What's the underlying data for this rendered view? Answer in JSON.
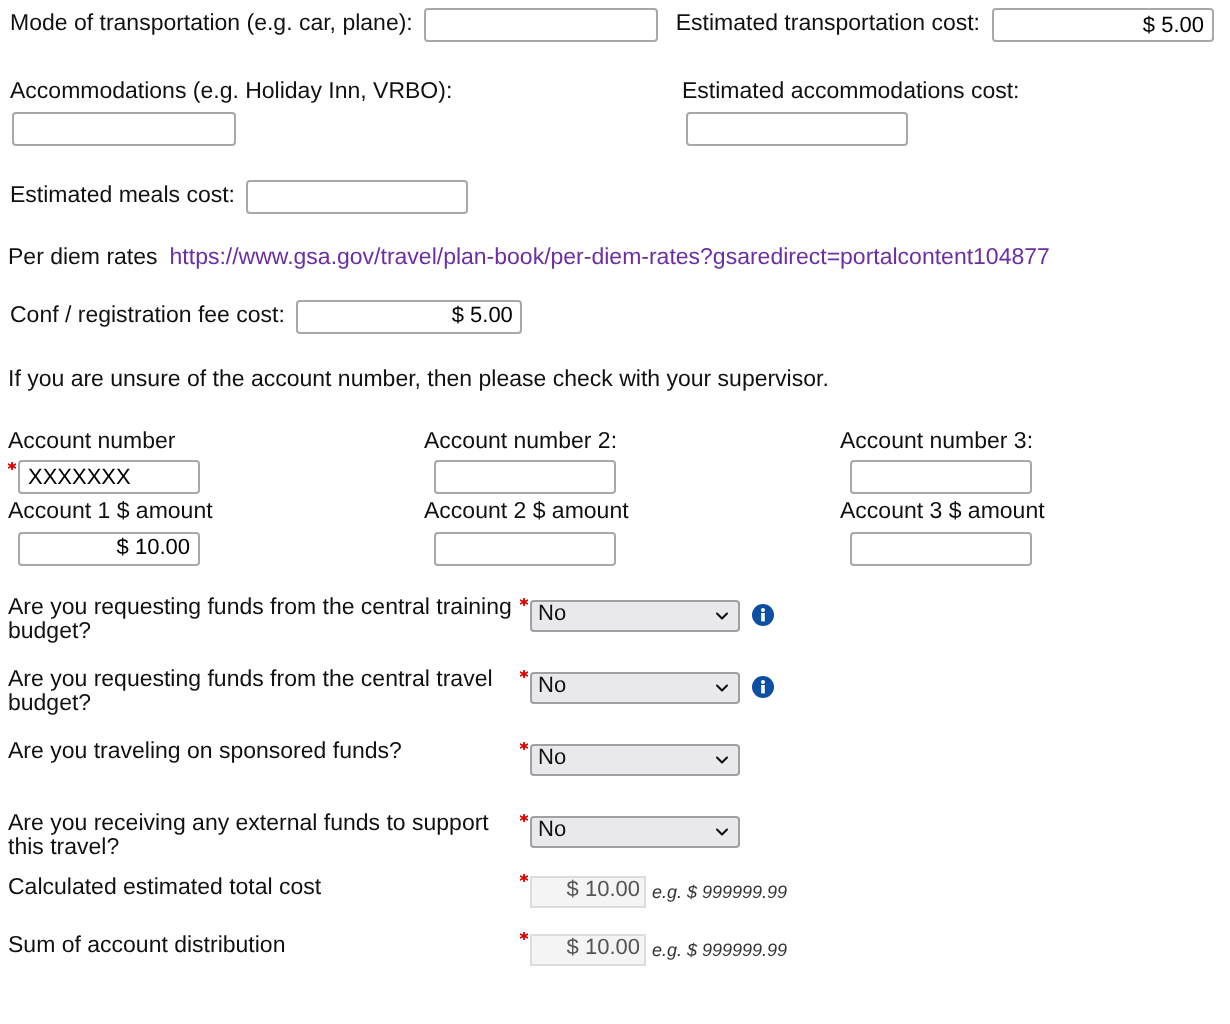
{
  "transportation": {
    "label": "Mode of transportation (e.g. car, plane):"
  },
  "transportation_cost": {
    "label": "Estimated transportation cost:",
    "value": "$ 5.00"
  },
  "accommodations": {
    "label": "Accommodations (e.g. Holiday Inn, VRBO):"
  },
  "accommodations_cost": {
    "label": "Estimated accommodations cost:"
  },
  "meals_cost": {
    "label": "Estimated meals cost:"
  },
  "per_diem": {
    "label": "Per diem rates",
    "link": "https://www.gsa.gov/travel/plan-book/per-diem-rates?gsaredirect=portalcontent104877"
  },
  "registration_cost": {
    "label": "Conf / registration fee cost:",
    "value": "$ 5.00"
  },
  "account_note": "If you are unsure of the account number, then please check with your supervisor.",
  "accounts": [
    {
      "number_label": "Account number",
      "number_value": "XXXXXXX",
      "required": true,
      "amount_label": "Account 1 $ amount",
      "amount_value": "$ 10.00"
    },
    {
      "number_label": "Account number 2:",
      "required": false,
      "amount_label": "Account 2 $ amount"
    },
    {
      "number_label": "Account number 3:",
      "required": false,
      "amount_label": "Account 3 $ amount"
    }
  ],
  "questions": [
    {
      "label": "Are you requesting funds from the central training budget?",
      "required": true,
      "value": "No",
      "info": true
    },
    {
      "label": "Are you requesting funds from the central travel budget?",
      "required": true,
      "value": "No",
      "info": true
    },
    {
      "label": "Are you traveling on sponsored funds?",
      "required": true,
      "value": "No",
      "info": false
    },
    {
      "label": "Are you receiving any external funds to support this travel?",
      "required": true,
      "value": "No",
      "info": false
    }
  ],
  "totals": [
    {
      "label": "Calculated estimated total cost",
      "required": true,
      "value": "$ 10.00",
      "hint": "e.g. $ 999999.99"
    },
    {
      "label": "Sum of account distribution",
      "required": true,
      "value": "$ 10.00",
      "hint": "e.g. $ 999999.99"
    }
  ]
}
